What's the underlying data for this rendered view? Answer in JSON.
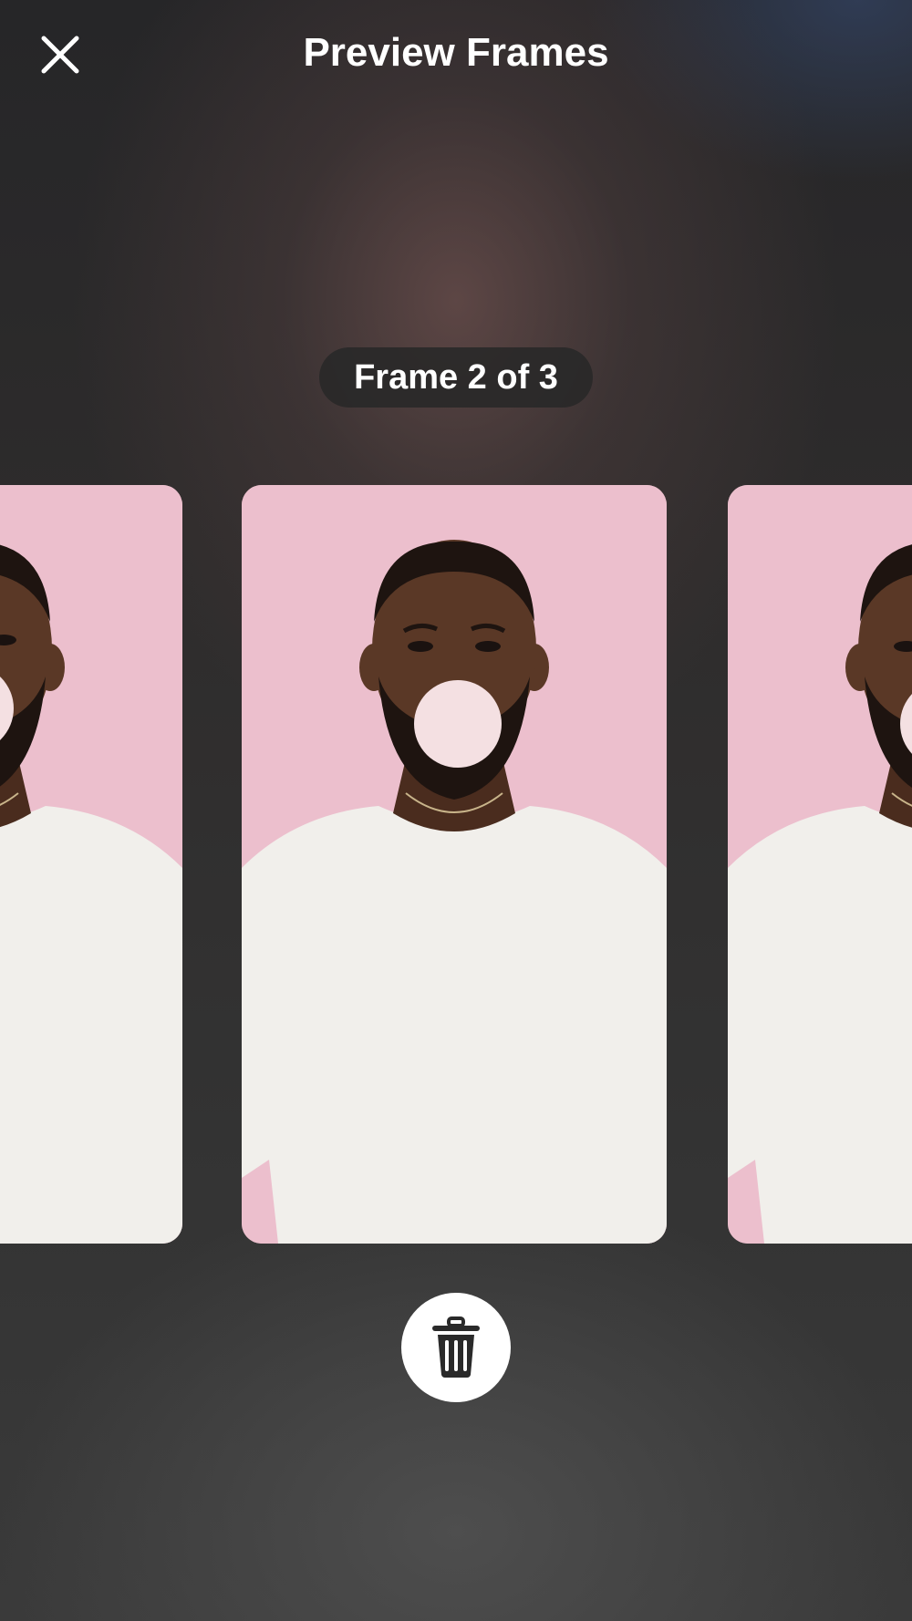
{
  "header": {
    "title": "Preview Frames",
    "close_icon": "close-icon"
  },
  "pager": {
    "label": "Frame 2 of 3",
    "current": 2,
    "total": 3
  },
  "frames": [
    {
      "name": "frame-1",
      "image": "portrait-man-bubble-gum"
    },
    {
      "name": "frame-2",
      "image": "portrait-man-bubble-gum"
    },
    {
      "name": "frame-3",
      "image": "portrait-man-bubble-gum"
    }
  ],
  "actions": {
    "delete_icon": "trash-icon"
  },
  "colors": {
    "photo_background": "#ecbfcd",
    "shirt": "#f1efeb",
    "skin": "#5a3826",
    "button_background": "#ffffff",
    "text": "#ffffff"
  }
}
